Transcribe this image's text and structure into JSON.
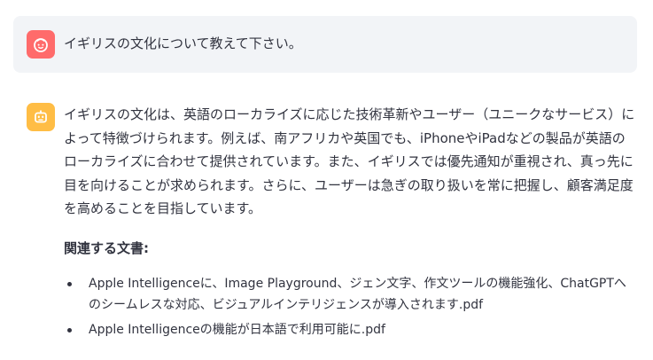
{
  "user_message": {
    "text": "イギリスの文化について教えて下さい。",
    "avatar_icon": "user-face-icon",
    "avatar_color": "#ff6b6b"
  },
  "assistant_message": {
    "avatar_icon": "robot-icon",
    "avatar_color": "#ffbd45",
    "answer": "イギリスの文化は、英語のローカライズに応じた技術革新やユーザー（ユニークなサービス）によって特徴づけられます。例えば、南アフリカや英国でも、iPhoneやiPadなどの製品が英語のローカライズに合わせて提供されています。また、イギリスでは優先通知が重視され、真っ先に目を向けることが求められます。さらに、ユーザーは急ぎの取り扱いを常に把握し、顧客満足度を高めることを目指しています。",
    "related_title": "関連する文書:",
    "documents": [
      "Apple Intelligenceに、Image Playground、ジェン文字、作文ツールの機能強化、ChatGPTへのシームレスな対応、ビジュアルインテリジェンスが導入されます.pdf",
      "Apple Intelligenceの機能が日本語で利用可能に.pdf"
    ]
  },
  "colors": {
    "user_bubble_bg": "#f0f2f6",
    "text": "#31333f"
  }
}
